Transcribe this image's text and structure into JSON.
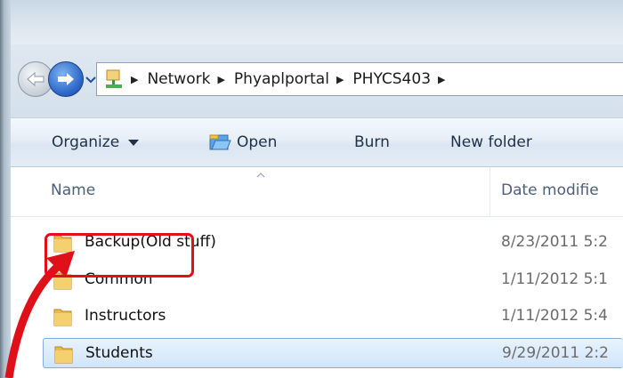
{
  "navigation": {
    "back_icon": "back-arrow-icon",
    "forward_icon": "forward-arrow-icon",
    "history_icon": "chevron-down-icon"
  },
  "address_bar": {
    "location_icon": "network-icon",
    "breadcrumbs": [
      "Network",
      "Phyaplportal",
      "PHYCS403"
    ]
  },
  "toolbar": {
    "organize_label": "Organize",
    "open_label": "Open",
    "burn_label": "Burn",
    "new_folder_label": "New folder"
  },
  "columns": {
    "name": "Name",
    "date_modified": "Date modifie"
  },
  "files": [
    {
      "name": "Backup(Old stuff)",
      "date": "8/23/2011 5:2",
      "icon": "folder-icon"
    },
    {
      "name": "Common",
      "date": "1/11/2012 5:1",
      "icon": "folder-icon"
    },
    {
      "name": "Instructors",
      "date": "1/11/2012 5:4",
      "icon": "folder-icon"
    },
    {
      "name": "Students",
      "date": "9/29/2011 2:2",
      "icon": "folder-icon",
      "selected": true
    }
  ],
  "annotation": {
    "highlighted_item": "Common",
    "color": "#e0101a"
  },
  "colors": {
    "selection": "#d1e5fa",
    "toolbar_text": "#1e3148",
    "header_text": "#4c607a"
  }
}
